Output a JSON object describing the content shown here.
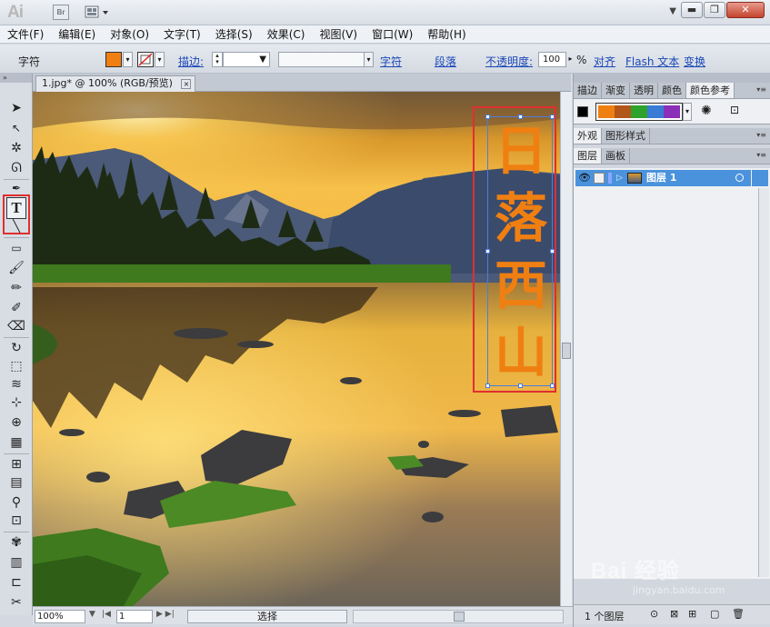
{
  "app": {
    "logo": "Ai",
    "bridge_label": "Br"
  },
  "menu": [
    "文件(F)",
    "编辑(E)",
    "对象(O)",
    "文字(T)",
    "选择(S)",
    "效果(C)",
    "视图(V)",
    "窗口(W)",
    "帮助(H)"
  ],
  "control": {
    "context_label": "字符",
    "fill_color": "#f07f12",
    "stroke_label": "描边:",
    "char_link": "字符",
    "para_link": "段落",
    "opacity_label": "不透明度:",
    "opacity_value": "100",
    "opacity_unit": "%",
    "align_link": "对齐",
    "flash_link": "Flash 文本",
    "transform_link": "变换"
  },
  "document": {
    "tab_label": "1.jpg* @ 100% (RGB/预览)",
    "close_glyph": "×"
  },
  "canvas": {
    "vertical_text": [
      "日",
      "落",
      "西",
      "山"
    ],
    "text_color": "#f07f12",
    "scene": "sunset lake mountains photo"
  },
  "status": {
    "zoom": "100%",
    "page": "1",
    "state": "选择"
  },
  "right_panel": {
    "swatch_tabs": [
      "描边",
      "渐变",
      "透明",
      "颜色",
      "颜色参考"
    ],
    "active_swatch_tab": "颜色参考",
    "harmony_colors": [
      "#f07f12",
      "#b2571a",
      "#2ea32c",
      "#3a7bd5",
      "#8b2fb8"
    ],
    "appearance_tabs": [
      "外观",
      "图形样式"
    ],
    "layer_tabs": [
      "图层",
      "画板"
    ],
    "layer_name": "图层 1",
    "layer_count": "1 个图层"
  },
  "watermark": {
    "text": "Bai 经验",
    "subtext": "jingyan.baidu.com"
  }
}
